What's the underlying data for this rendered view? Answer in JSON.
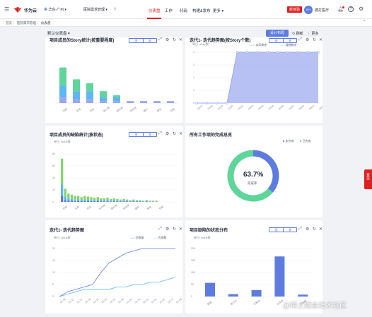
{
  "colors": {
    "accent": "#5e7ce0",
    "brand_red": "#e02020",
    "green": "#5ed59b",
    "lightgreen": "#86d46b",
    "sky": "#5cb8f2",
    "lavender": "#9aa6f0"
  },
  "topbar": {
    "brand": "华为云",
    "region": "华东-广州",
    "project": "医院需求管理",
    "nav": [
      "仪表盘",
      "工作",
      "代码",
      "构建&发布",
      "更多"
    ],
    "active_nav": "仪表盘",
    "trial_badge": "新体验",
    "avatar_initials": "ZHY",
    "user_name": "德打医疗"
  },
  "breadcrumb": [
    "首页",
    "医院需求管理",
    "仪表盘"
  ],
  "dashboard": {
    "selector": "默认仪表盘",
    "design_button": "设计布局",
    "refresh": "刷新",
    "more": "更多"
  },
  "float_tab": "意见",
  "watermark": "@稀土掘金技术社区",
  "panels": {
    "p1": {
      "title": "项目成员的Story统计(按重要程度)",
      "seg": [
        "图",
        "表"
      ],
      "categories": [
        "刘桥",
        "沈海",
        "刘浩",
        "张小刚",
        "唐红明",
        "张佳佳",
        "康乐",
        "黄恒",
        "刘旭"
      ]
    },
    "p2": {
      "title": "迭代1- 迭代趋势图(按Story个数)",
      "unit": "单位: story数",
      "legend": [
        "实际剩余",
        "理想剩余"
      ],
      "seg": [
        "图",
        "表"
      ],
      "x": [
        "03/14",
        "03/16",
        "03/18",
        "03/20",
        "03/22",
        "03/24",
        "03/26",
        "03/28",
        "03/30",
        "04/01",
        "04/03",
        "04/05",
        "04/07"
      ],
      "y_ticks": [
        "4",
        "3",
        "2",
        "1",
        "0"
      ]
    },
    "p3": {
      "title": "项目成员的缺陷统计(按状态)",
      "unit": "单位: Issue数",
      "seg": [
        "图",
        "表"
      ],
      "y_ticks": [
        "80",
        "60",
        "40",
        "20",
        "0"
      ],
      "categories": [
        "刘桥",
        "沈海",
        "刘浩",
        "张小刚",
        "唐红明",
        "张佳佳",
        "康乐",
        "黄恒",
        "刘旭"
      ]
    },
    "p4": {
      "title": "所有工作项的完成总览",
      "legend": [
        "未完成",
        "已完成"
      ],
      "percent": "63.7%",
      "percent_label": "完成率"
    },
    "p5": {
      "title": "迭代1- 迭代趋势图",
      "unit": "单位: Issue数",
      "legend": [
        "总数量",
        "完成数"
      ],
      "x": [
        "04-10",
        "04-12",
        "04-14",
        "04-16",
        "04-18",
        "04-20",
        "04-22",
        "04-24",
        "04-26",
        "04-28",
        "05-01",
        "05-03",
        "05-05",
        "05-07",
        "05-09"
      ],
      "y_ticks": [
        "20",
        "15",
        "10",
        "5",
        "0"
      ]
    },
    "p6": {
      "title": "项目缺陷的状态分布",
      "unit": "单位: Issue数",
      "seg": [
        "图",
        "表"
      ],
      "categories": [
        "新建",
        "进行中",
        "已解决",
        "已关闭",
        "已拒绝"
      ],
      "y_ticks": [
        "200",
        "150",
        "100",
        "50",
        "0"
      ]
    }
  },
  "chart_data": [
    {
      "type": "bar",
      "title": "项目成员的Story统计(按重要程度)",
      "categories": [
        "刘桥",
        "沈海",
        "刘浩",
        "张小刚",
        "唐红明",
        "张佳佳",
        "康乐",
        "黄恒",
        "刘旭"
      ],
      "series": [
        {
          "values": [
            3,
            2,
            2,
            1,
            1,
            1,
            1,
            1,
            1
          ]
        },
        {
          "values": [
            6,
            4,
            4,
            2,
            2,
            0,
            0,
            0,
            0
          ]
        },
        {
          "values": [
            9,
            6,
            4,
            3,
            1,
            0,
            0,
            0,
            0
          ]
        }
      ]
    },
    {
      "type": "line",
      "title": "迭代1- 迭代趋势图(按Story个数)",
      "ylabel": "story数",
      "x": [
        "03/14",
        "03/16",
        "03/18",
        "03/20",
        "03/22",
        "03/24",
        "03/26",
        "03/28",
        "03/30",
        "04/01",
        "04/03",
        "04/05",
        "04/07"
      ],
      "ylim": [
        0,
        4
      ],
      "series": [
        {
          "name": "实际剩余",
          "values": [
            0,
            0,
            0,
            0,
            4,
            4,
            4,
            4,
            4,
            4,
            4,
            4,
            4
          ]
        }
      ]
    },
    {
      "type": "bar",
      "title": "项目成员的缺陷统计(按状态)",
      "ylabel": "Issue数",
      "ylim": [
        0,
        80
      ],
      "categories": [
        "刘桥",
        "沈海",
        "刘浩",
        "张小刚",
        "唐红明",
        "张佳佳",
        "康乐",
        "黄恒",
        "刘旭"
      ],
      "values": [
        72,
        22,
        14,
        12,
        10,
        10,
        8,
        10,
        9,
        8,
        7,
        8,
        6,
        6,
        7,
        5,
        6,
        5,
        4,
        5,
        4,
        3,
        4,
        3,
        3,
        2,
        3,
        2,
        2,
        2
      ]
    },
    {
      "type": "pie",
      "title": "所有工作项的完成总览",
      "labels": [
        "未完成",
        "已完成"
      ],
      "values": [
        36.3,
        63.7
      ]
    },
    {
      "type": "line",
      "title": "迭代1- 迭代趋势图",
      "ylabel": "Issue数",
      "ylim": [
        0,
        20
      ],
      "x": [
        "04-10",
        "04-12",
        "04-14",
        "04-16",
        "04-18",
        "04-20",
        "04-22",
        "04-24",
        "04-26",
        "04-28",
        "05-01",
        "05-03",
        "05-05",
        "05-07",
        "05-09"
      ],
      "series": [
        {
          "name": "总数量",
          "values": [
            0,
            2,
            3,
            4,
            5,
            10,
            14,
            16,
            18,
            19,
            20,
            20,
            20,
            20,
            20
          ]
        },
        {
          "name": "完成数",
          "values": [
            0,
            1,
            2,
            3,
            3,
            3,
            3,
            4,
            4,
            5,
            5,
            6,
            6,
            7,
            8
          ]
        }
      ]
    },
    {
      "type": "bar",
      "title": "项目缺陷的状态分布",
      "ylabel": "Issue数",
      "ylim": [
        0,
        200
      ],
      "categories": [
        "新建",
        "进行中",
        "已解决",
        "已关闭",
        "已拒绝"
      ],
      "values": [
        57,
        10,
        27,
        167,
        8
      ]
    }
  ]
}
